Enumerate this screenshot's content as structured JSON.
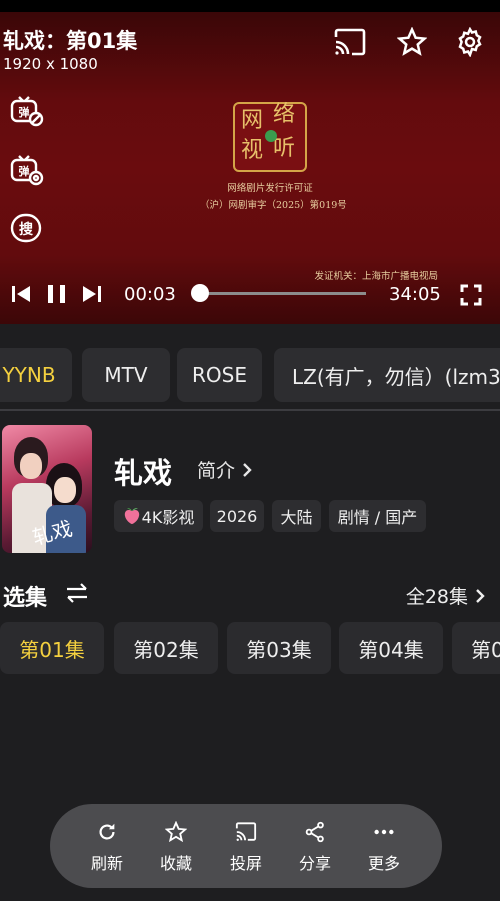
{
  "player": {
    "title": "轧戏：第01集",
    "resolution": "1920 x 1080",
    "icons": [
      "cast-icon",
      "star-icon",
      "gear-icon"
    ],
    "side_icons": [
      "danmaku-off-icon",
      "danmaku-settings-icon",
      "search-icon"
    ],
    "side_search_label": "搜",
    "license_seal_chars": [
      "网",
      "络",
      "视",
      "听"
    ],
    "license_line1": "网络剧片发行许可证",
    "license_line2": "（沪）网剧审字（2025）第019号",
    "issuer": "发证机关：上海市广播电视局",
    "current_time": "00:03",
    "duration": "34:05",
    "progress": 0.0015
  },
  "sources": [
    "YYNB",
    "MTV",
    "ROSE",
    "LZ(有广，勿信）(lzm3"
  ],
  "active_source": "YYNB",
  "detail": {
    "title": "轧戏",
    "intro_label": "简介",
    "tags": [
      "4K影视",
      "2026",
      "大陆",
      "剧情 / 国产"
    ],
    "poster_text": "轧戏"
  },
  "episodes": {
    "heading": "选集",
    "total_label": "全28集",
    "items": [
      "第01集",
      "第02集",
      "第03集",
      "第04集",
      "第0"
    ],
    "active": "第01集"
  },
  "bottom_bar": [
    {
      "label": "刷新",
      "icon": "refresh-icon"
    },
    {
      "label": "收藏",
      "icon": "star-icon"
    },
    {
      "label": "投屏",
      "icon": "cast-icon"
    },
    {
      "label": "分享",
      "icon": "share-icon"
    },
    {
      "label": "更多",
      "icon": "more-icon"
    }
  ],
  "colors": {
    "accent": "#f4d03f",
    "player_bg": "#5e0a0d",
    "page_bg": "#1e1e20",
    "chip_bg": "#2d2d30"
  }
}
